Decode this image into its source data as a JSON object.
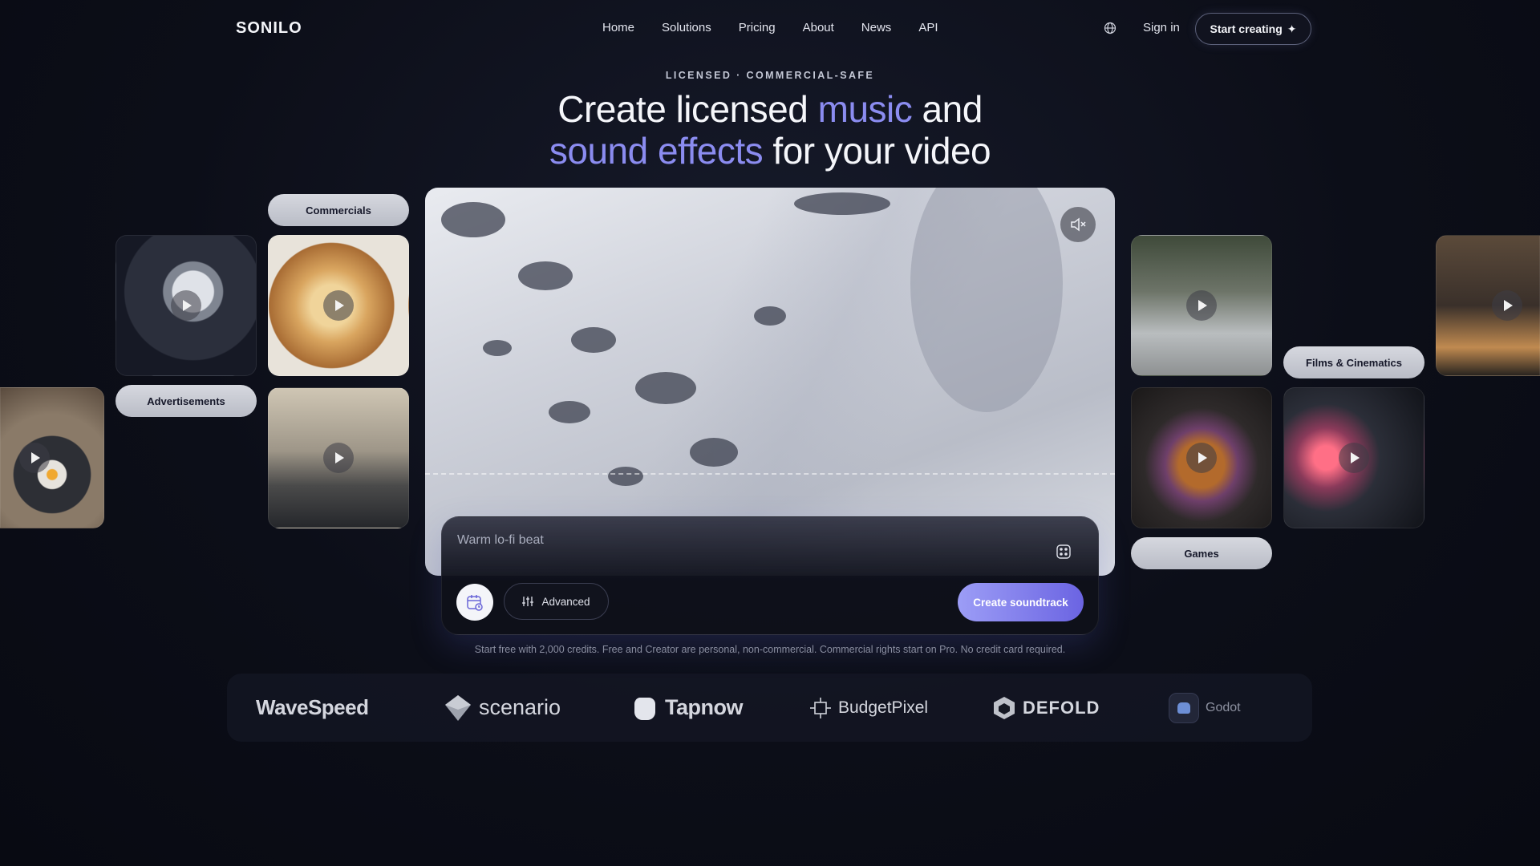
{
  "brand": {
    "name": "SONILO"
  },
  "nav": {
    "items": [
      "Home",
      "Solutions",
      "Pricing",
      "About",
      "News",
      "API"
    ],
    "sign_in": "Sign in",
    "start_creating": "Start creating"
  },
  "hero": {
    "eyebrow": "LICENSED · COMMERCIAL-SAFE",
    "line1_a": "Create licensed ",
    "line1_accent": "music",
    "line1_b": " and",
    "line2_accent": "sound effects",
    "line2_b": " for your video",
    "accent_color": "#8b8cf0"
  },
  "categories": {
    "commercials": "Commercials",
    "advertisements": "Advertisements",
    "films": "Films & Cinematics",
    "games": "Games"
  },
  "prompt": {
    "placeholder": "Warm lo-fi beat",
    "advanced_label": "Advanced",
    "create_label": "Create soundtrack"
  },
  "disclaimer": "Start free with 2,000 credits. Free and Creator are personal, non-commercial. Commercial rights start on Pro. No credit card required.",
  "partners": [
    "WaveSpeed",
    "scenario",
    "Tapnow",
    "BudgetPixel",
    "DEFOLD",
    "Godot"
  ]
}
